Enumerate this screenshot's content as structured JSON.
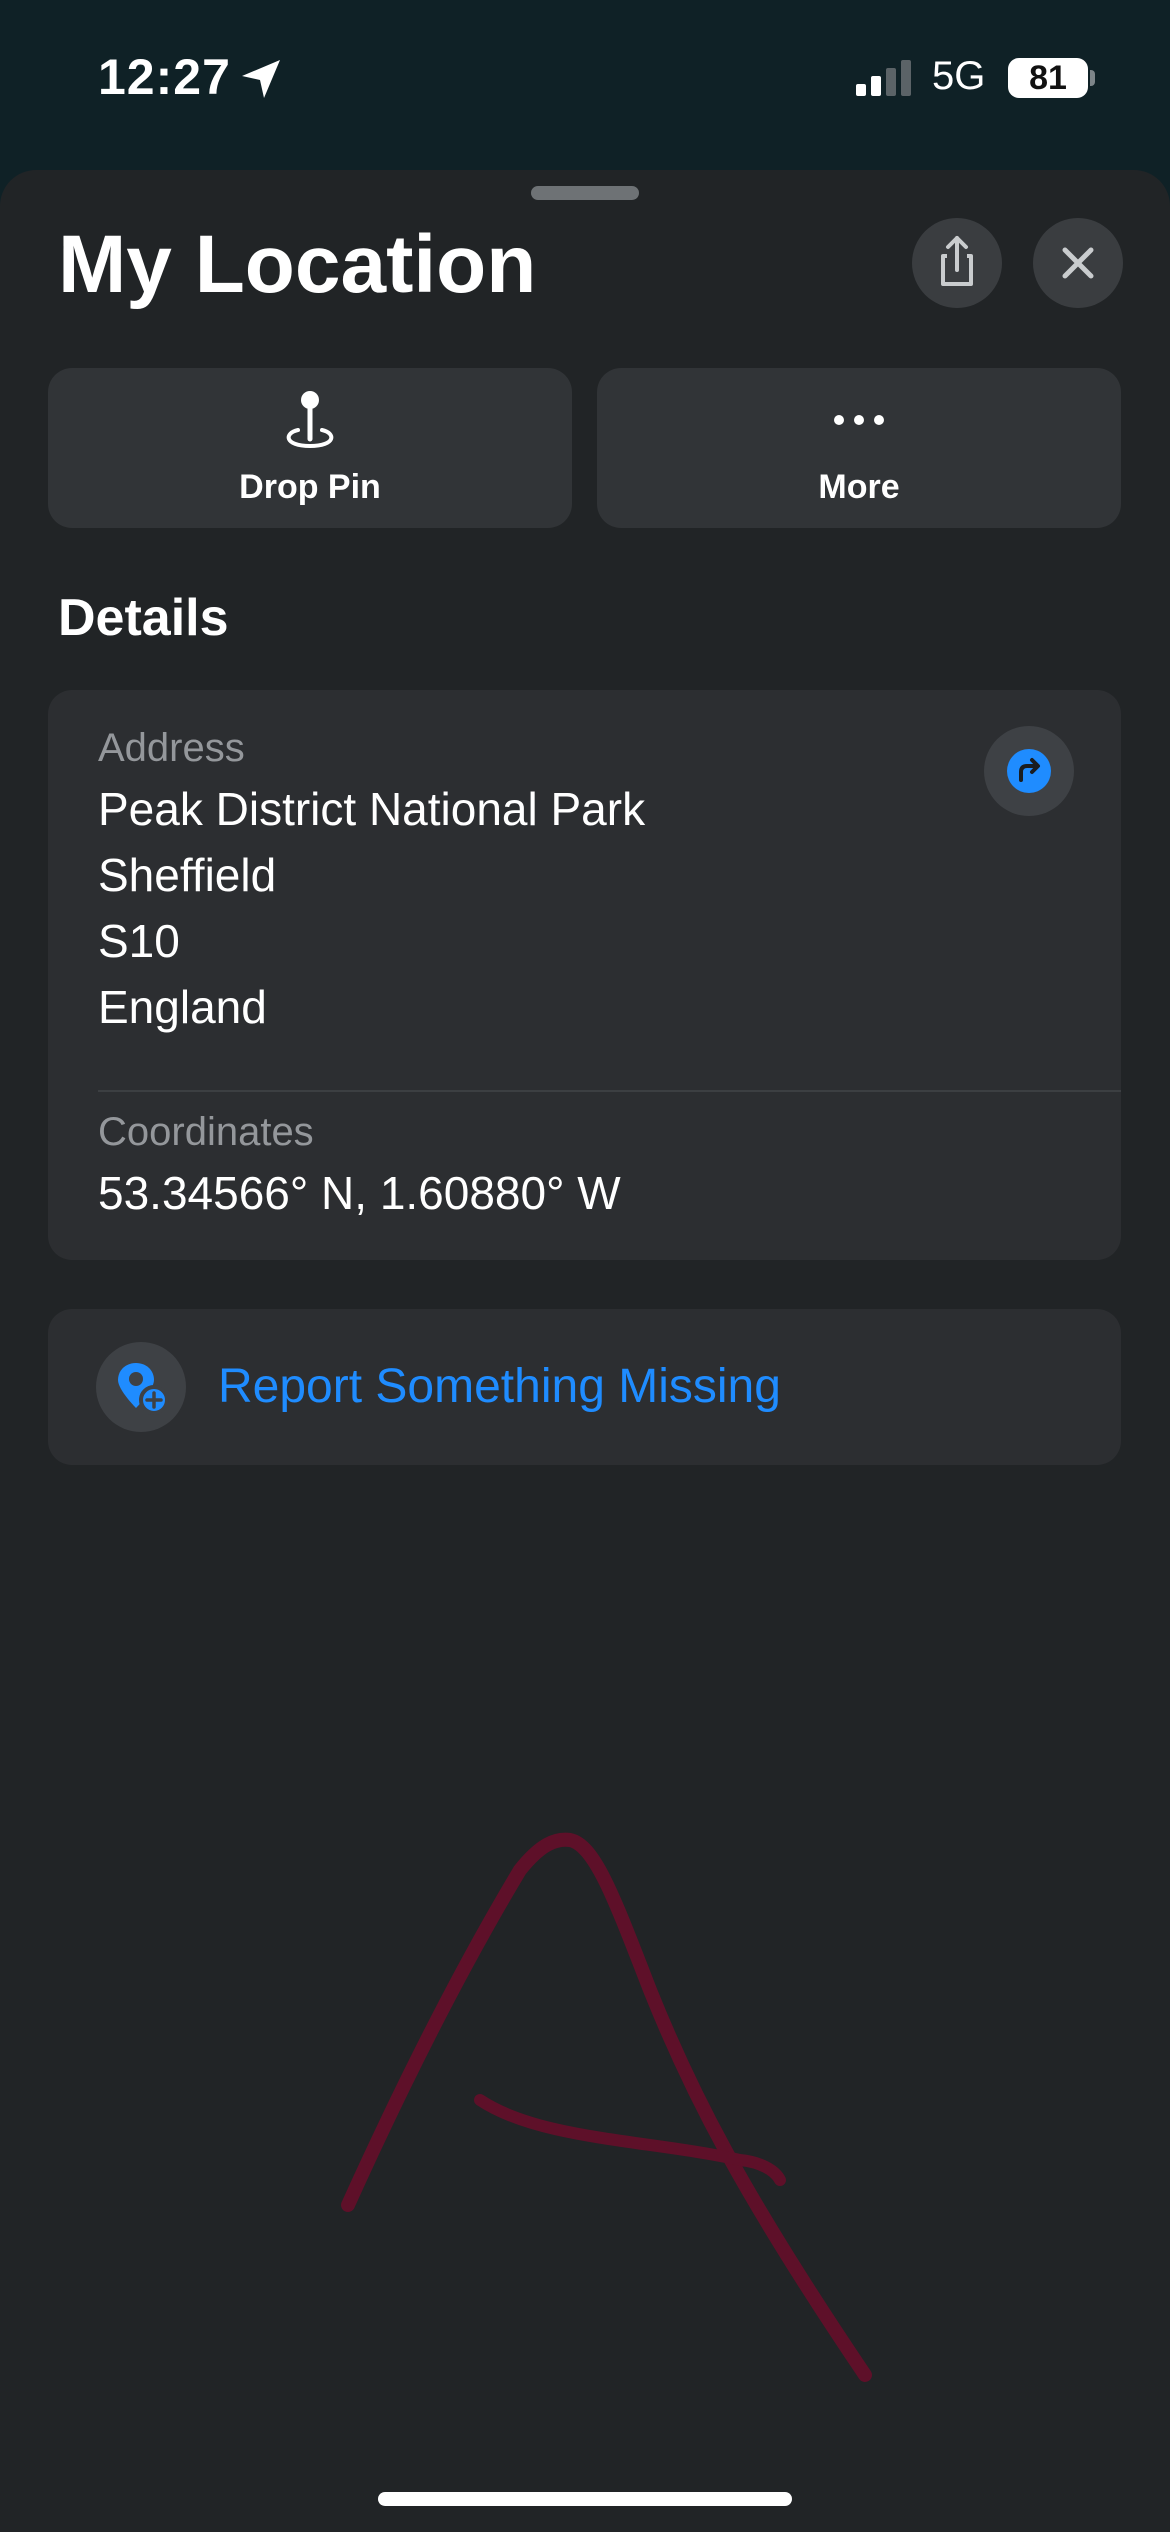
{
  "status_bar": {
    "time": "12:27",
    "network": "5G",
    "battery": "81",
    "icons": [
      "location-arrow-icon",
      "signal-icon",
      "battery-icon"
    ]
  },
  "sheet": {
    "title": "My Location",
    "icons": [
      "share-icon",
      "close-icon"
    ]
  },
  "actions": [
    {
      "label": "Drop Pin",
      "icon": "drop-pin-icon"
    },
    {
      "label": "More",
      "icon": "ellipsis-icon"
    }
  ],
  "details": {
    "heading": "Details",
    "address_label": "Address",
    "address_lines": [
      "Peak District National Park",
      "Sheffield",
      "S10",
      "England"
    ],
    "coordinates_label": "Coordinates",
    "coordinates_value": "53.34566° N, 1.60880° W",
    "directions_icon": "directions-icon"
  },
  "report": {
    "label": "Report Something Missing",
    "icon": "map-pin-plus-icon"
  },
  "colors": {
    "accent": "#1f8cff",
    "sheet_background": "#212426",
    "card_background": "#2c2e31",
    "drawing_stroke": "#5e1029"
  }
}
